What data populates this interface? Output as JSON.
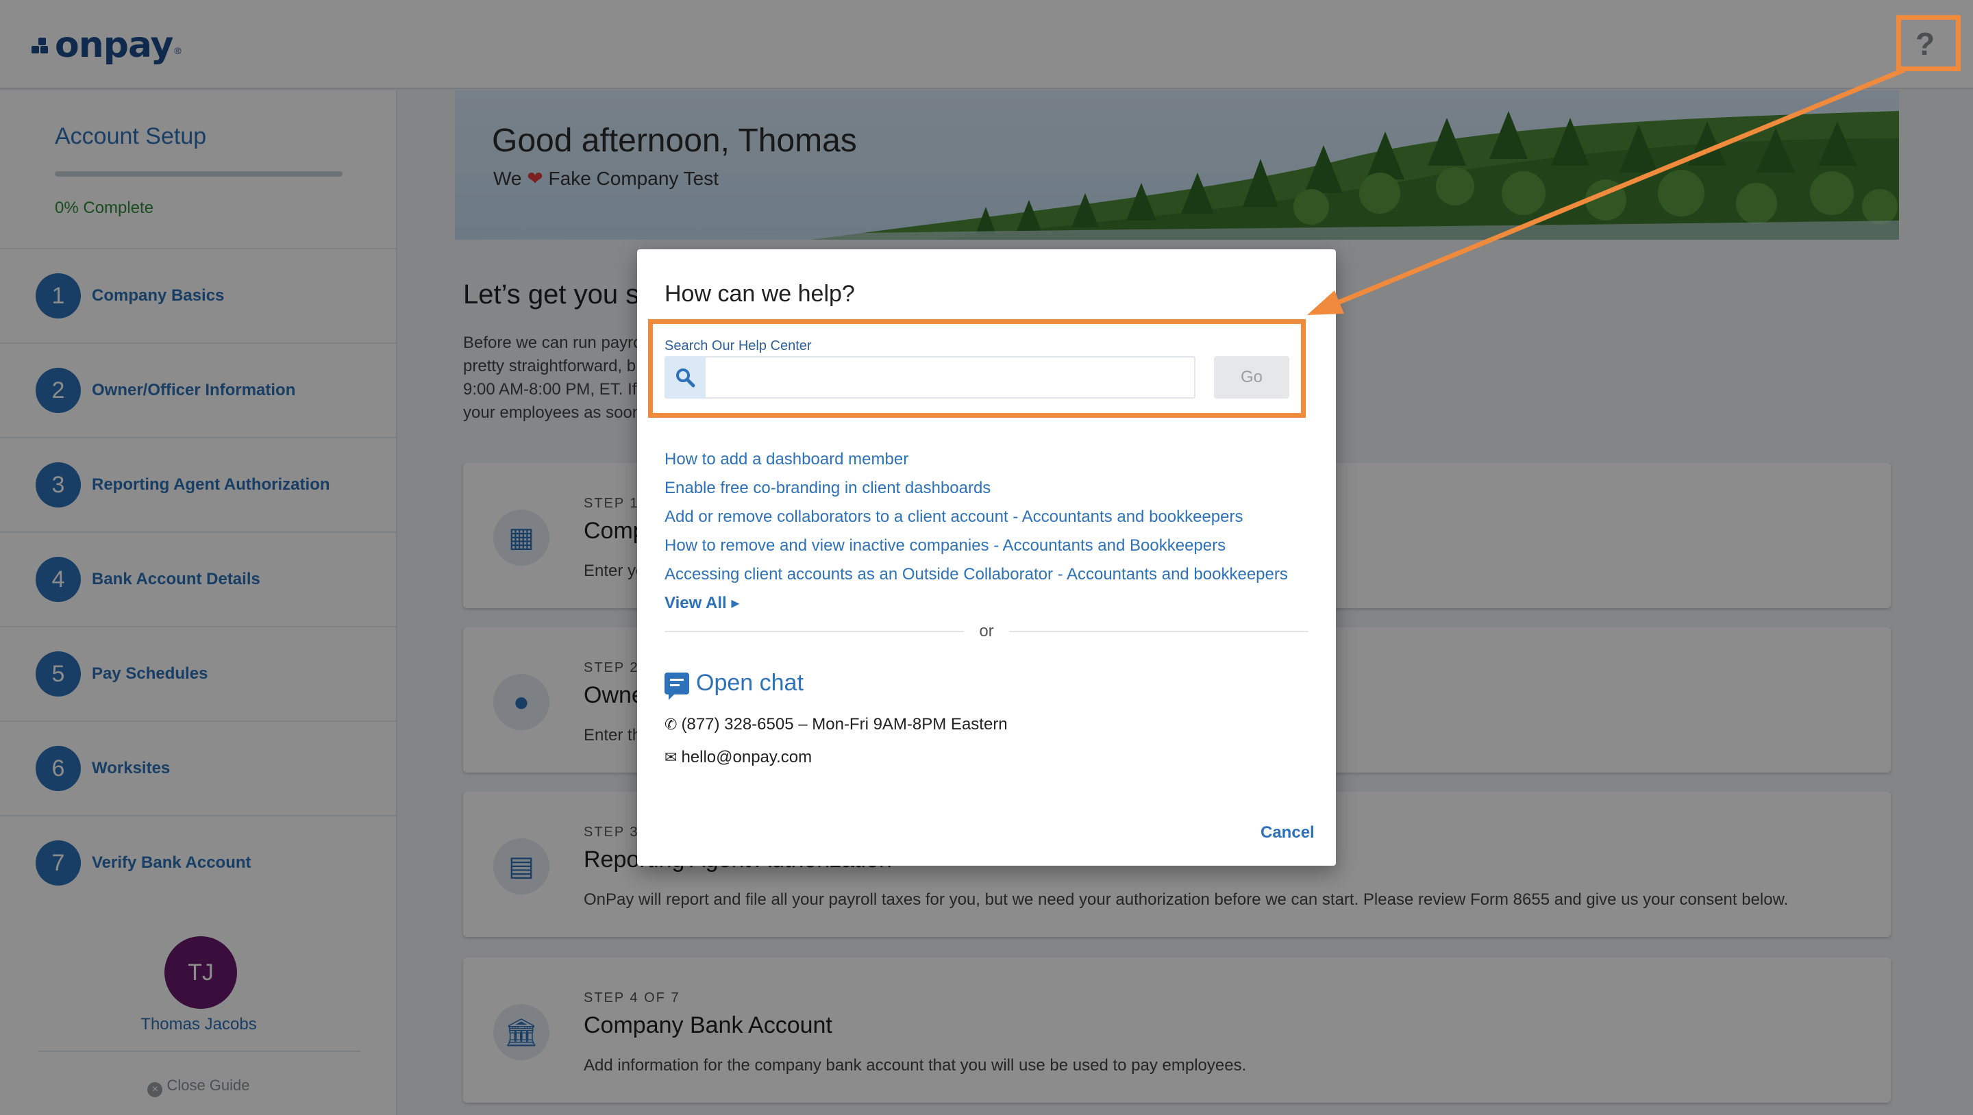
{
  "brand": {
    "logo_text": "onpay",
    "logo_mark": "®",
    "accent": "#2d72b8",
    "highlight": "#f08a3c"
  },
  "header": {
    "help_icon": "question-icon",
    "help_glyph": "?"
  },
  "sidebar": {
    "title": "Account Setup",
    "progress_text": "0% Complete",
    "progress_value": 0,
    "items": [
      {
        "num": "1",
        "label": "Company Basics"
      },
      {
        "num": "2",
        "label": "Owner/Officer Information"
      },
      {
        "num": "3",
        "label": "Reporting Agent Authorization"
      },
      {
        "num": "4",
        "label": "Bank Account Details"
      },
      {
        "num": "5",
        "label": "Pay Schedules"
      },
      {
        "num": "6",
        "label": "Worksites"
      },
      {
        "num": "7",
        "label": "Verify Bank Account"
      }
    ],
    "user": {
      "initials": "TJ",
      "name": "Thomas Jacobs"
    },
    "close_guide": "Close Guide"
  },
  "main": {
    "greeting": "Good afternoon, Thomas",
    "sub_prefix": "We",
    "sub_suffix": "Fake Company Test",
    "intro_title": "Let’s get you s",
    "intro_lines": [
      "Before we can run payro",
      "pretty straightforward, b",
      "9:00 AM-8:00 PM, ET. If",
      "your employees as soon"
    ],
    "steps": [
      {
        "kicker": "STEP 1",
        "title": "Comp",
        "desc": "Enter yo",
        "icon": "building-icon"
      },
      {
        "kicker": "STEP 2",
        "title": "Owne",
        "desc": "Enter th",
        "icon": "person-icon"
      },
      {
        "kicker": "STEP 3",
        "title": "Reporting Agent Authorization",
        "desc": "OnPay will report and file all your payroll taxes for you, but we need your authorization before we can start. Please review Form 8655 and give us your consent below.",
        "icon": "document-icon"
      },
      {
        "kicker": "STEP 4 OF 7",
        "title": "Company Bank Account",
        "desc": "Add information for the company bank account that you will use be used to pay employees.",
        "icon": "bank-icon"
      }
    ]
  },
  "modal": {
    "title": "How can we help?",
    "search_label": "Search Our Help Center",
    "search_value": "",
    "search_placeholder": "",
    "go_label": "Go",
    "links": [
      "How to add a dashboard member",
      "Enable free co-branding in client dashboards",
      "Add or remove collaborators to a client account - Accountants and bookkeepers",
      "How to remove and view inactive companies - Accountants and Bookkeepers",
      "Accessing client accounts as an Outside Collaborator - Accountants and bookkeepers"
    ],
    "view_all": "View All",
    "or_text": "or",
    "open_chat": "Open chat",
    "phone": "(877) 328-6505 – Mon-Fri 9AM-8PM Eastern",
    "email": "hello@onpay.com",
    "cancel": "Cancel"
  }
}
